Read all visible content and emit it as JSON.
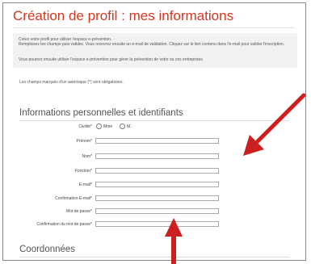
{
  "page": {
    "title": "Création de profil : mes informations",
    "intro": [
      "Créez votre profil pour utiliser l'espace e-prévention.",
      "Remplissez les champs puis validez. Vous recevrez ensuite un e-mail de validation. Cliquez sur le lien contenu dans l'e-mail pour valider l'inscription.",
      "Vous pourrez ensuite utiliser l'espace e-prévention pour gérer la prévention de votre ou vos entreprises."
    ],
    "required_note": "Les champs marqués d'un astérisque (*) sont obligatoires."
  },
  "section_personal": {
    "title": "Informations personnelles et identifiants",
    "civilite_label": "Civilité*",
    "civilite_options": [
      "Mme",
      "M."
    ],
    "fields": [
      {
        "label": "Prénom*",
        "value": ""
      },
      {
        "label": "Nom*",
        "value": ""
      },
      {
        "label": "Fonction*",
        "value": ""
      },
      {
        "label": "E-mail*",
        "value": ""
      },
      {
        "label": "Confirmation E-mail*",
        "value": ""
      },
      {
        "label": "Mot de passe*",
        "value": ""
      },
      {
        "label": "Confirmation du mot de passe*",
        "value": ""
      }
    ]
  },
  "section_contact": {
    "title": "Coordonnées"
  },
  "annotation_color": "#cc1f1f"
}
